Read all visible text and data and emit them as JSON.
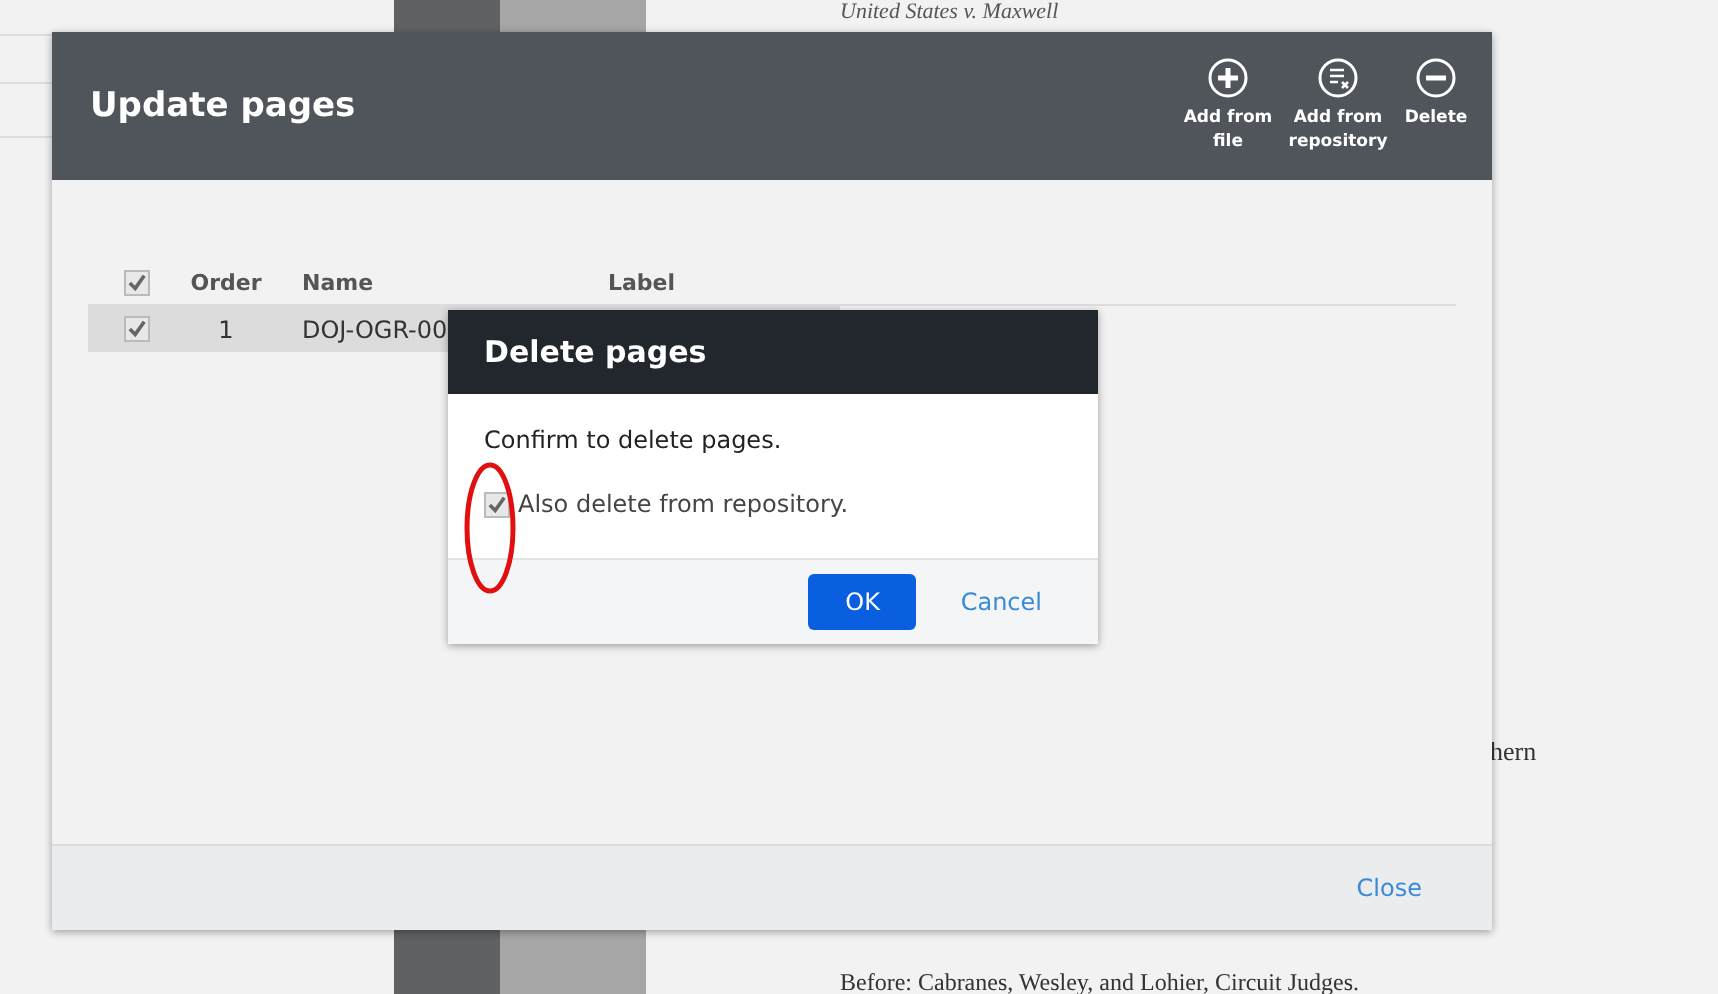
{
  "document": {
    "caption": "United States v. Maxwell",
    "fragment": "hern",
    "byline": "Before: Cabranes, Wesley, and Lohier, Circuit Judges."
  },
  "update_dialog": {
    "title": "Update pages",
    "actions": [
      {
        "kind": "add",
        "label": "Add from file"
      },
      {
        "kind": "repository",
        "label": "Add from repository"
      },
      {
        "kind": "remove",
        "label": "Delete"
      }
    ],
    "table": {
      "all_checked": true,
      "columns": [
        "Order",
        "Name",
        "Label"
      ],
      "rows": [
        {
          "checked": true,
          "selected": true,
          "order": "1",
          "name": "DOJ-OGR-00",
          "label": ""
        }
      ]
    },
    "close": "Close"
  },
  "delete_dialog": {
    "title": "Delete pages",
    "message": "Confirm to delete pages.",
    "option": {
      "label": "Also delete from repository.",
      "checked": true
    },
    "ok": "OK",
    "cancel": "Cancel"
  }
}
